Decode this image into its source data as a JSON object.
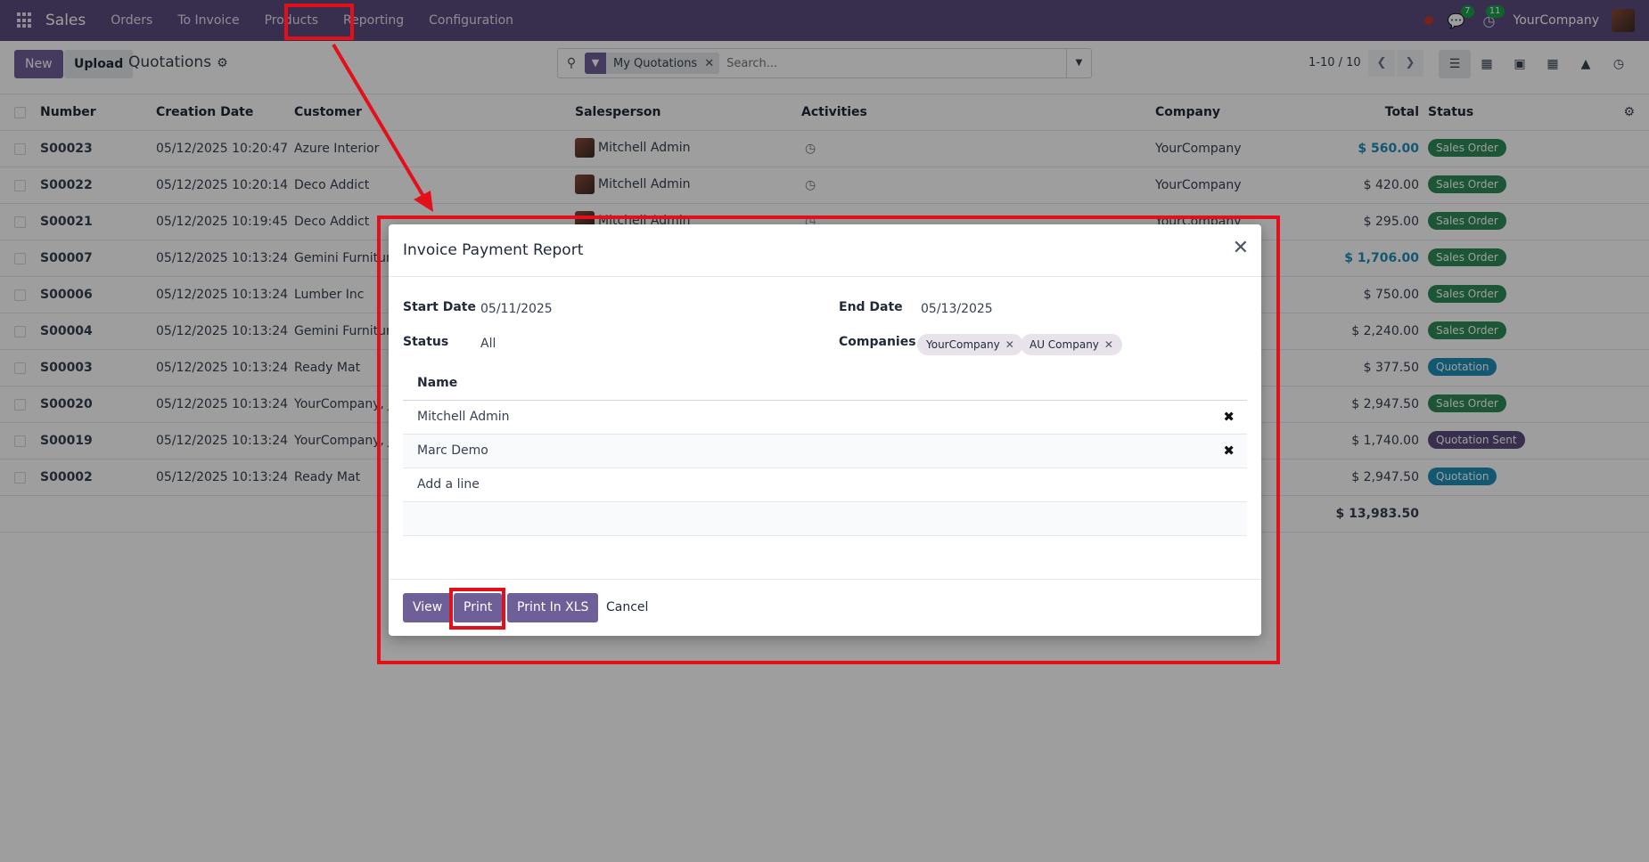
{
  "navbar": {
    "brand": "Sales",
    "menu": [
      "Orders",
      "To Invoice",
      "Products",
      "Reporting",
      "Configuration"
    ],
    "messages_count": "7",
    "activities_count": "11",
    "company": "YourCompany"
  },
  "control": {
    "new_label": "New",
    "upload_label": "Upload",
    "breadcrumb": "Quotations",
    "search_facet": "My Quotations",
    "search_placeholder": "Search...",
    "pager": "1-10 / 10"
  },
  "list": {
    "headers": {
      "number": "Number",
      "creation_date": "Creation Date",
      "customer": "Customer",
      "salesperson": "Salesperson",
      "activities": "Activities",
      "company": "Company",
      "total": "Total",
      "status": "Status"
    },
    "rows": [
      {
        "number": "S00023",
        "date": "05/12/2025 10:20:47",
        "customer": "Azure Interior",
        "salesperson": "Mitchell Admin",
        "company": "YourCompany",
        "total": "$ 560.00",
        "status": "Sales Order"
      },
      {
        "number": "S00022",
        "date": "05/12/2025 10:20:14",
        "customer": "Deco Addict",
        "salesperson": "Mitchell Admin",
        "company": "YourCompany",
        "total": "$ 420.00",
        "status": "Sales Order"
      },
      {
        "number": "S00021",
        "date": "05/12/2025 10:19:45",
        "customer": "Deco Addict",
        "salesperson": "Mitchell Admin",
        "company": "YourCompany",
        "total": "$ 295.00",
        "status": "Sales Order"
      },
      {
        "number": "S00007",
        "date": "05/12/2025 10:13:24",
        "customer": "Gemini Furniture",
        "salesperson": "",
        "company": "",
        "total": "$ 1,706.00",
        "status": "Sales Order"
      },
      {
        "number": "S00006",
        "date": "05/12/2025 10:13:24",
        "customer": "Lumber Inc",
        "salesperson": "",
        "company": "",
        "total": "$ 750.00",
        "status": "Sales Order"
      },
      {
        "number": "S00004",
        "date": "05/12/2025 10:13:24",
        "customer": "Gemini Furniture",
        "salesperson": "",
        "company": "",
        "total": "$ 2,240.00",
        "status": "Sales Order"
      },
      {
        "number": "S00003",
        "date": "05/12/2025 10:13:24",
        "customer": "Ready Mat",
        "salesperson": "",
        "company": "",
        "total": "$ 377.50",
        "status": "Quotation"
      },
      {
        "number": "S00020",
        "date": "05/12/2025 10:13:24",
        "customer": "YourCompany, Jo",
        "salesperson": "",
        "company": "",
        "total": "$ 2,947.50",
        "status": "Sales Order"
      },
      {
        "number": "S00019",
        "date": "05/12/2025 10:13:24",
        "customer": "YourCompany, Jo",
        "salesperson": "",
        "company": "",
        "total": "$ 1,740.00",
        "status": "Quotation Sent"
      },
      {
        "number": "S00002",
        "date": "05/12/2025 10:13:24",
        "customer": "Ready Mat",
        "salesperson": "",
        "company": "",
        "total": "$ 2,947.50",
        "status": "Quotation"
      }
    ],
    "sum_total": "$ 13,983.50"
  },
  "modal": {
    "title": "Invoice Payment Report",
    "start_date_label": "Start Date",
    "start_date": "05/11/2025",
    "end_date_label": "End Date",
    "end_date": "05/13/2025",
    "status_label": "Status",
    "status": "All",
    "companies_label": "Companies",
    "companies": [
      "YourCompany",
      "AU Company"
    ],
    "table_header": "Name",
    "lines": [
      "Mitchell Admin",
      "Marc Demo"
    ],
    "add_line": "Add a line",
    "buttons": {
      "view": "View",
      "print": "Print",
      "print_xls": "Print In XLS",
      "cancel": "Cancel"
    }
  },
  "colors": {
    "navbar": "#5b4b7e",
    "primary": "#6f5f98",
    "annotation": "#e3101b",
    "status_sales_order": "#2e8b57",
    "status_quotation": "#1d8fb7"
  },
  "icons": [
    "apps-icon",
    "search-icon",
    "filter-icon",
    "gear-icon",
    "clock-icon",
    "close-icon",
    "trash-icon",
    "settings-icon",
    "chat-icon"
  ]
}
